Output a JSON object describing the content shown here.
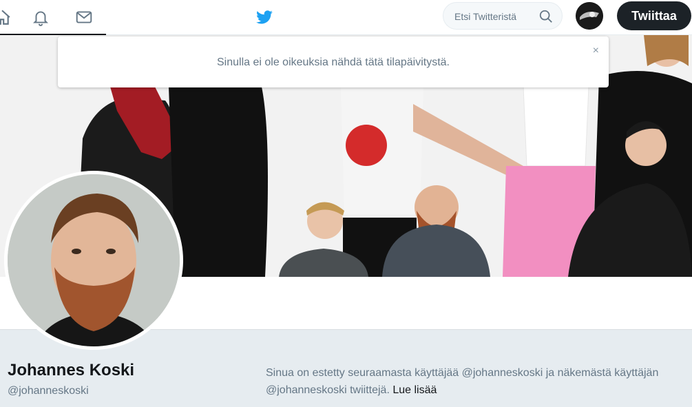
{
  "topbar": {
    "search_placeholder": "Etsi Twitteristä",
    "tweet_button": "Twiittaa"
  },
  "notice": {
    "text": "Sinulla ei ole oikeuksia nähdä tätä tilapäivitystä.",
    "close": "×"
  },
  "profile": {
    "name": "Johannes Koski",
    "handle": "@johanneskoski"
  },
  "blocked": {
    "text": "Sinua on estetty seuraamasta käyttäjää @johanneskoski ja näkemästä käyttäjän @johanneskoski twiittejä.",
    "link": "Lue lisää"
  },
  "colors": {
    "accent": "#1da1f2",
    "tweet_button_bg": "#1c2227",
    "page_bg": "#e6ecf0"
  },
  "icons": [
    "home-icon",
    "notifications-icon",
    "messages-icon",
    "twitter-bird-icon",
    "search-icon",
    "close-icon"
  ]
}
